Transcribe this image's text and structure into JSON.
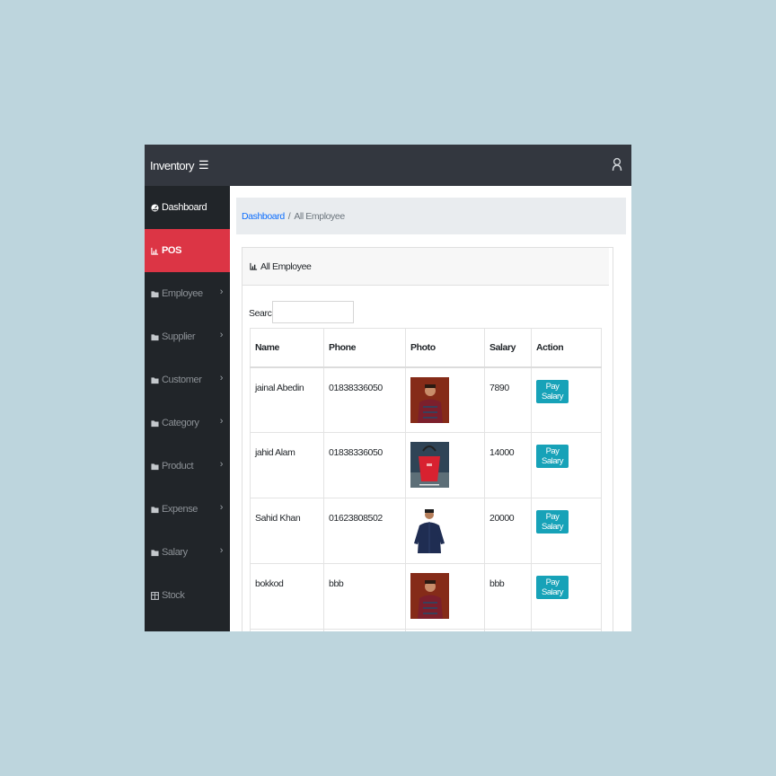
{
  "topbar": {
    "brand": "Inventory",
    "menu_icon": "hamburger-icon",
    "user_icon": "user-icon"
  },
  "sidebar": {
    "items": [
      {
        "label": "Dashboard",
        "icon": "dashboard-icon",
        "state": "header"
      },
      {
        "label": "POS",
        "icon": "chart-icon",
        "state": "active"
      },
      {
        "label": "Employee",
        "icon": "folder-icon",
        "chevron": true
      },
      {
        "label": "Supplier",
        "icon": "folder-icon",
        "chevron": true
      },
      {
        "label": "Customer",
        "icon": "folder-icon",
        "chevron": true
      },
      {
        "label": "Category",
        "icon": "folder-icon",
        "chevron": true
      },
      {
        "label": "Product",
        "icon": "folder-icon",
        "chevron": true
      },
      {
        "label": "Expense",
        "icon": "folder-icon",
        "chevron": true
      },
      {
        "label": "Salary",
        "icon": "folder-icon",
        "chevron": true
      },
      {
        "label": "Stock",
        "icon": "table-icon"
      }
    ]
  },
  "breadcrumb": {
    "link": "Dashboard",
    "separator": "/",
    "current": "All Employee"
  },
  "card": {
    "title": "All Employee"
  },
  "search": {
    "label": "Search:",
    "value": ""
  },
  "table": {
    "headers": [
      "Name",
      "Phone",
      "Photo",
      "Salary",
      "Action"
    ],
    "rows": [
      {
        "name": "jainal Abedin",
        "phone": "01838336050",
        "photo": "man-red-shirt",
        "salary": "7890",
        "action": "Pay Salary"
      },
      {
        "name": "jahid Alam",
        "phone": "01838336050",
        "photo": "red-handbag",
        "salary": "14000",
        "action": "Pay Salary"
      },
      {
        "name": "Sahid Khan",
        "phone": "01623808502",
        "photo": "man-denim-shirt",
        "salary": "20000",
        "action": "Pay Salary"
      },
      {
        "name": "bokkod",
        "phone": "bbb",
        "photo": "man-red-shirt",
        "salary": "bbb",
        "action": "Pay Salary"
      }
    ]
  },
  "colors": {
    "topbar": "#33373f",
    "sidebar": "#212529",
    "active": "#dc3545",
    "link": "#0d6efd",
    "button": "#17a2b8",
    "backdrop": "#bdd5dd"
  }
}
